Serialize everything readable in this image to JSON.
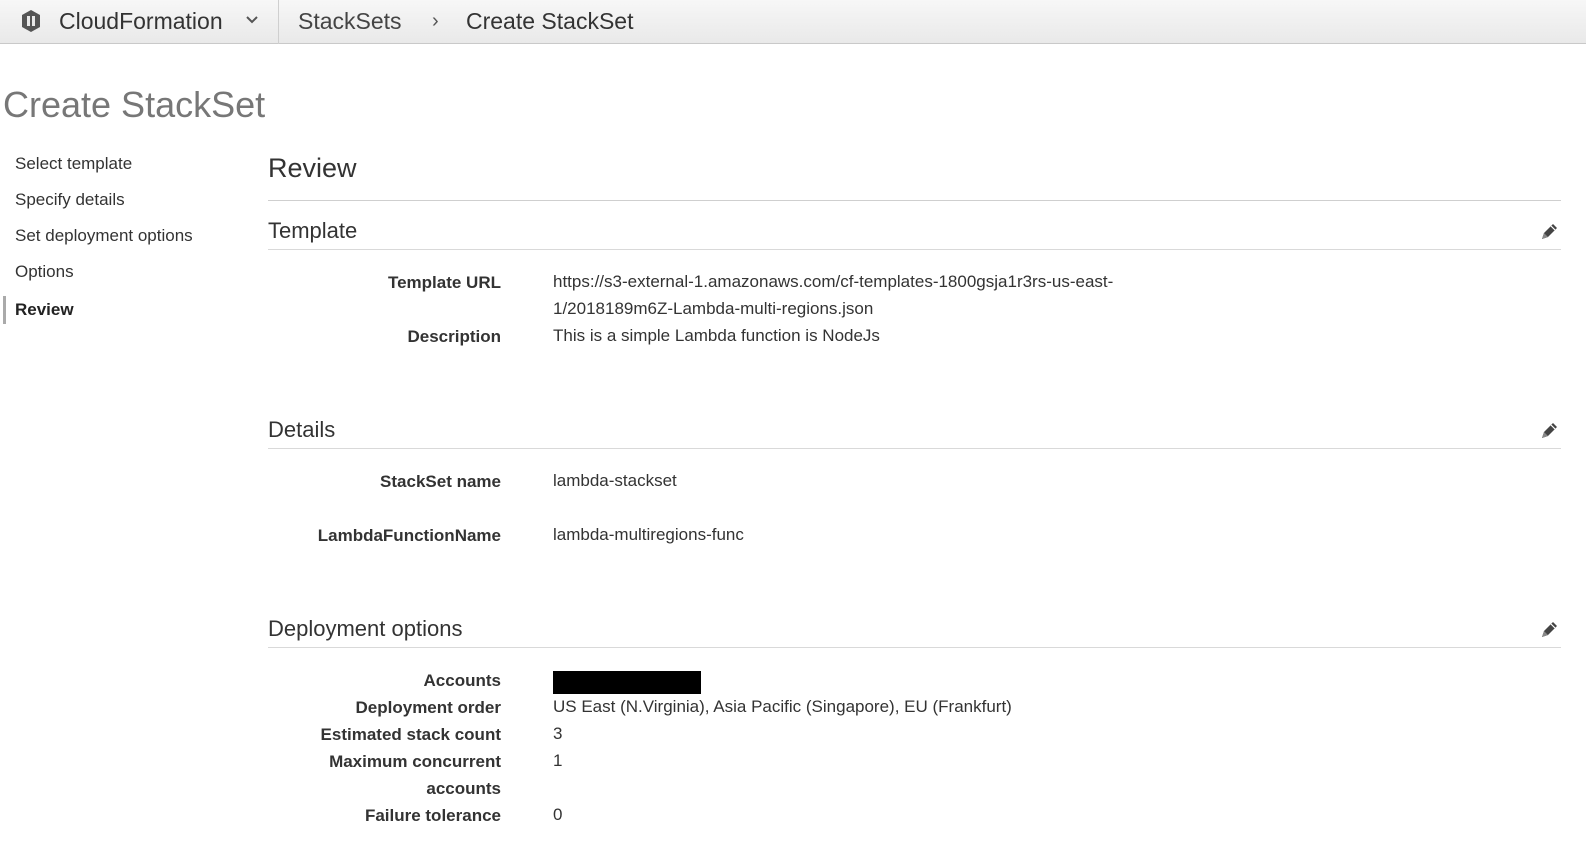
{
  "nav": {
    "service": "CloudFormation",
    "breadcrumb_parent": "StackSets",
    "breadcrumb_separator": "›",
    "breadcrumb_current": "Create StackSet"
  },
  "page_title": "Create StackSet",
  "steps": [
    {
      "label": "Select template",
      "active": false
    },
    {
      "label": "Specify details",
      "active": false
    },
    {
      "label": "Set deployment options",
      "active": false
    },
    {
      "label": "Options",
      "active": false
    },
    {
      "label": "Review",
      "active": true
    }
  ],
  "review": {
    "title": "Review",
    "template": {
      "title": "Template",
      "url_label": "Template URL",
      "url_line1": "https://s3-external-1.amazonaws.com/cf-templates-1800gsja1r3rs-us-east-",
      "url_line2": "1/2018189m6Z-Lambda-multi-regions.json",
      "description_label": "Description",
      "description": "This is a simple Lambda function is NodeJs"
    },
    "details": {
      "title": "Details",
      "stackset_name_label": "StackSet name",
      "stackset_name": "lambda-stackset",
      "param_label": "LambdaFunctionName",
      "param_value": "lambda-multiregions-func"
    },
    "deployment": {
      "title": "Deployment options",
      "accounts_label": "Accounts",
      "order_label": "Deployment order",
      "order": "US East (N.Virginia), Asia Pacific (Singapore), EU (Frankfurt)",
      "count_label": "Estimated stack count",
      "count": "3",
      "max_label_line1": "Maximum concurrent",
      "max_label_line2": "accounts",
      "max": "1",
      "failure_label": "Failure tolerance",
      "failure": "0"
    }
  },
  "icons": {
    "service": "cloudformation-icon",
    "caret": "chevron-down-icon",
    "edit": "pencil-icon"
  },
  "colors": {
    "topbar": "#ececec",
    "title_gray": "#777777",
    "redaction": "#000000"
  }
}
